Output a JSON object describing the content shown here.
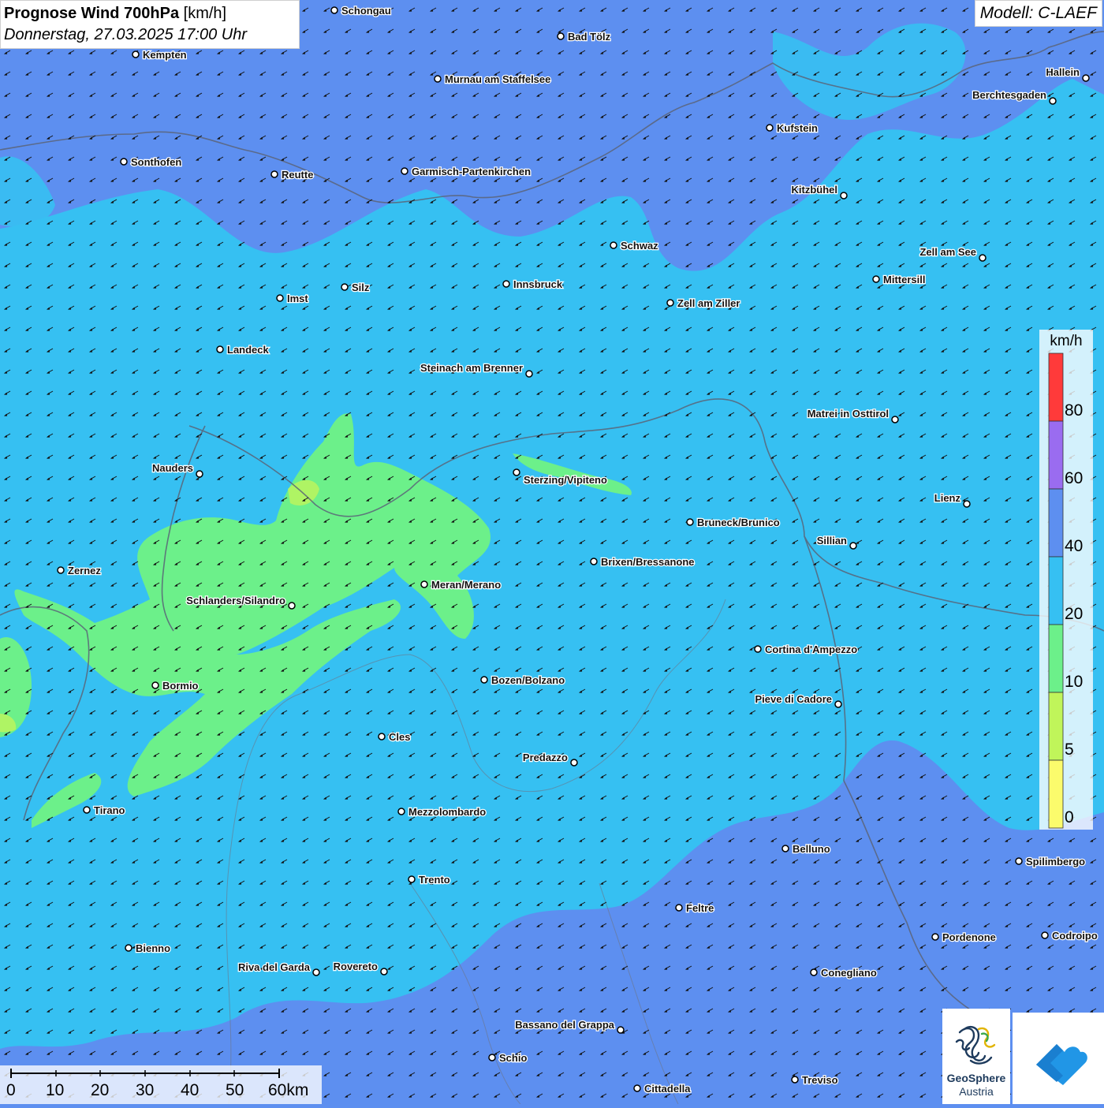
{
  "title": {
    "bold": "Prognose Wind 700hPa",
    "unit": " [km/h]",
    "subtitle": "Donnerstag, 27.03.2025 17:00 Uhr"
  },
  "model": "Modell: C-LAEF",
  "legend": {
    "unit": "km/h",
    "ticks": [
      "80",
      "60",
      "40",
      "20",
      "10",
      "5",
      "0"
    ],
    "colors": [
      "#ff3a3a",
      "#9a6cf0",
      "#5d8ff0",
      "#36c0f2",
      "#6cf08a",
      "#c0f55a",
      "#fbfb6c"
    ]
  },
  "scalebar": {
    "labels": [
      "0",
      "10",
      "20",
      "30",
      "40",
      "50",
      "60km"
    ]
  },
  "logo": {
    "line1": "GeoSphere",
    "line2": "Austria"
  },
  "wind_arrow_direction": "towards-southwest",
  "colors": {
    "background": "#5d8ff0",
    "band_20_40": "#36c0f2",
    "band_10_20": "#6cf08a",
    "band_5_10": "#c0f55a"
  },
  "cities": [
    {
      "name": "Schongau"
    },
    {
      "name": "Bad Tölz"
    },
    {
      "name": "Kempten"
    },
    {
      "name": "Murnau am Staffelsee"
    },
    {
      "name": "Hallein"
    },
    {
      "name": "Berchtesgaden"
    },
    {
      "name": "Kufstein"
    },
    {
      "name": "Sonthofen"
    },
    {
      "name": "Reutte"
    },
    {
      "name": "Garmisch-Partenkirchen"
    },
    {
      "name": "Kitzbühel"
    },
    {
      "name": "Schwaz"
    },
    {
      "name": "Zell am See"
    },
    {
      "name": "Mittersill"
    },
    {
      "name": "Innsbruck"
    },
    {
      "name": "Silz"
    },
    {
      "name": "Imst"
    },
    {
      "name": "Zell am Ziller"
    },
    {
      "name": "Landeck"
    },
    {
      "name": "Steinach am Brenner"
    },
    {
      "name": "Matrei in Osttirol"
    },
    {
      "name": "Nauders"
    },
    {
      "name": "Sterzing/Vipiteno"
    },
    {
      "name": "Lienz"
    },
    {
      "name": "Bruneck/Brunico"
    },
    {
      "name": "Sillian"
    },
    {
      "name": "Brixen/Bressanone"
    },
    {
      "name": "Zernez"
    },
    {
      "name": "Meran/Merano"
    },
    {
      "name": "Schlanders/Silandro"
    },
    {
      "name": "Cortina d'Ampezzo"
    },
    {
      "name": "Bozen/Bolzano"
    },
    {
      "name": "Bormio"
    },
    {
      "name": "Pieve di Cadore"
    },
    {
      "name": "Cles"
    },
    {
      "name": "Predazzo"
    },
    {
      "name": "Tirano"
    },
    {
      "name": "Mezzolombardo"
    },
    {
      "name": "Belluno"
    },
    {
      "name": "Spilimbergo"
    },
    {
      "name": "Trento"
    },
    {
      "name": "Feltre"
    },
    {
      "name": "Pordenone"
    },
    {
      "name": "Codroipo"
    },
    {
      "name": "Bienno"
    },
    {
      "name": "Riva del Garda"
    },
    {
      "name": "Rovereto"
    },
    {
      "name": "Conegliano"
    },
    {
      "name": "Bassano del Grappa"
    },
    {
      "name": "Schio"
    },
    {
      "name": "Treviso"
    },
    {
      "name": "Cittadella"
    }
  ]
}
